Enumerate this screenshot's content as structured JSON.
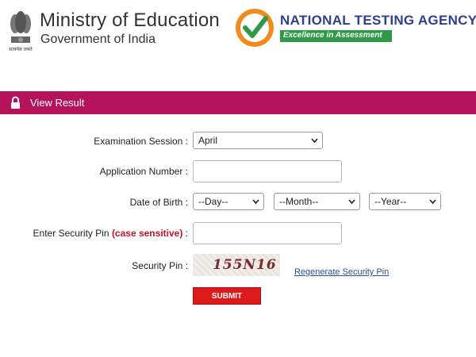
{
  "header": {
    "emblem_motto": "सत्यमेव जयते",
    "ministry_title": "Ministry of Education",
    "ministry_subtitle": "Government of India",
    "agency_title": "NATIONAL TESTING AGENCY",
    "agency_tagline": "Excellence in Assessment"
  },
  "titlebar": {
    "label": "View Result",
    "icon": "lock-icon",
    "color": "#b5125c"
  },
  "form": {
    "session": {
      "label": "Examination Session :",
      "selected": "April"
    },
    "application_number": {
      "label": "Application Number :",
      "value": ""
    },
    "dob": {
      "label": "Date of Birth :",
      "day": "--Day--",
      "month": "--Month--",
      "year": "--Year--"
    },
    "security_pin_input": {
      "label_prefix": "Enter Security Pin",
      "label_note": "(case sensitive)",
      "label_suffix": " :",
      "value": ""
    },
    "security_pin": {
      "label": "Security Pin :",
      "captcha_text": "155N16",
      "regenerate_label": "Regenerate Security Pin"
    },
    "submit_label": "SUBMIT"
  }
}
